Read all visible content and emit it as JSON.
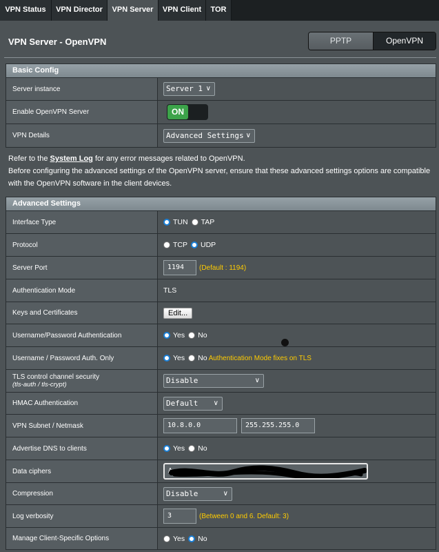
{
  "tabs": [
    {
      "label": "VPN Status"
    },
    {
      "label": "VPN Director"
    },
    {
      "label": "VPN Server"
    },
    {
      "label": "VPN Client"
    },
    {
      "label": "TOR"
    }
  ],
  "header": {
    "title": "VPN Server - OpenVPN",
    "protocol_switch": [
      "PPTP",
      "OpenVPN"
    ],
    "selected_protocol": "OpenVPN"
  },
  "basic_config": {
    "title": "Basic Config",
    "server_instance": {
      "label": "Server instance",
      "value": "Server 1"
    },
    "enable_server": {
      "label": "Enable OpenVPN Server",
      "value": "ON"
    },
    "vpn_details": {
      "label": "VPN Details",
      "value": "Advanced Settings"
    }
  },
  "info": {
    "line1_prefix": "Refer to the ",
    "line1_link": "System Log",
    "line1_suffix": " for any error messages related to OpenVPN.",
    "line2": "Before configuring the advanced settings of the OpenVPN server, ensure that these advanced settings options are compatible with the OpenVPN software in the client devices."
  },
  "advanced": {
    "title": "Advanced Settings",
    "interface_type": {
      "label": "Interface Type",
      "options": [
        "TUN",
        "TAP"
      ],
      "selected": "TUN"
    },
    "protocol": {
      "label": "Protocol",
      "options": [
        "TCP",
        "UDP"
      ],
      "selected": "UDP"
    },
    "server_port": {
      "label": "Server Port",
      "value": "1194",
      "hint": "(Default : 1194)"
    },
    "auth_mode": {
      "label": "Authentication Mode",
      "value": "TLS"
    },
    "keys_certs": {
      "label": "Keys and Certificates",
      "button": "Edit..."
    },
    "userpass_auth": {
      "label": "Username/Password Authentication",
      "options": [
        "Yes",
        "No"
      ],
      "selected": "Yes"
    },
    "userpass_only": {
      "label": "Username / Password Auth. Only",
      "options": [
        "Yes",
        "No"
      ],
      "selected": "Yes",
      "hint": "Authentication Mode fixes on TLS"
    },
    "tls_control": {
      "label": "TLS control channel security",
      "sublabel": "(tls-auth / tls-crypt)",
      "value": "Disable"
    },
    "hmac": {
      "label": "HMAC Authentication",
      "value": "Default"
    },
    "subnet": {
      "label": "VPN Subnet / Netmask",
      "subnet": "10.8.0.0",
      "netmask": "255.255.255.0"
    },
    "advertise_dns": {
      "label": "Advertise DNS to clients",
      "options": [
        "Yes",
        "No"
      ],
      "selected": "Yes"
    },
    "data_ciphers": {
      "label": "Data ciphers",
      "value": "A"
    },
    "compression": {
      "label": "Compression",
      "value": "Disable"
    },
    "log_verbosity": {
      "label": "Log verbosity",
      "value": "3",
      "hint": "(Between 0 and 6. Default: 3)"
    },
    "client_specific": {
      "label": "Manage Client-Specific Options",
      "options": [
        "Yes",
        "No"
      ],
      "selected": "No"
    }
  },
  "colors": {
    "accent_on": "#3ca34a",
    "hint": "#ffcc00",
    "radio_selected": "#1a7fd6"
  }
}
